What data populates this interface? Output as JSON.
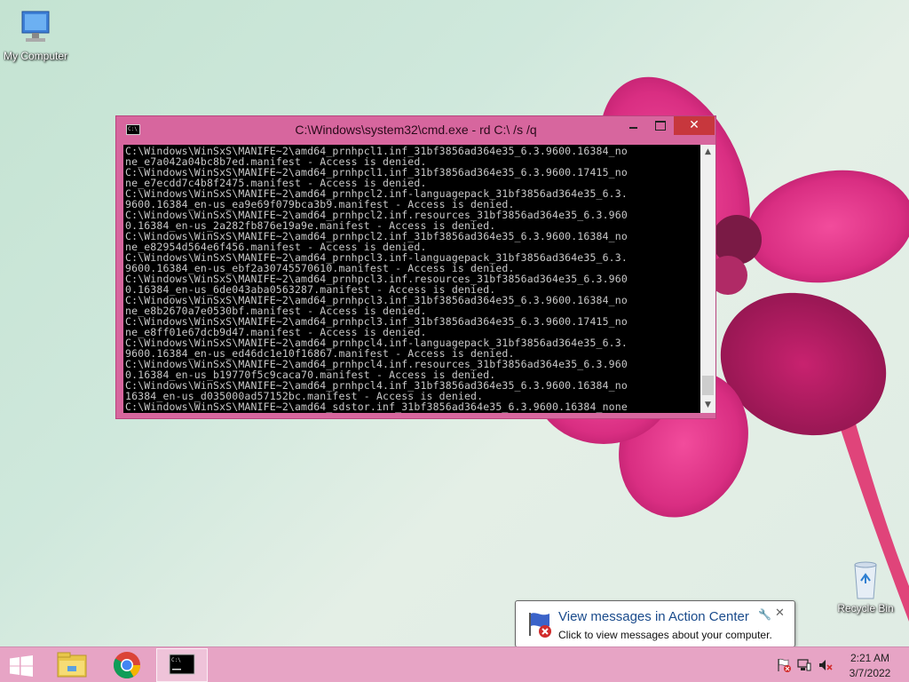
{
  "desktop": {
    "icons": [
      {
        "label": "My Computer",
        "icon": "computer-icon"
      },
      {
        "label": "Recycle Bin",
        "icon": "recycle-bin-icon"
      }
    ]
  },
  "cmd_window": {
    "title": "C:\\Windows\\system32\\cmd.exe - rd  C:\\ /s /q",
    "icon": "cmd-icon",
    "title_icon_text": "C:\\",
    "controls": {
      "minimize": "minimize",
      "maximize": "maximize",
      "close": "✕"
    },
    "colors": {
      "frame": "#d7669e",
      "close": "#c7373d"
    },
    "lines": [
      "C:\\Windows\\WinSxS\\MANIFE~2\\amd64_prnhpcl1.inf_31bf3856ad364e35_6.3.9600.16384_no",
      "ne_e7a042a04bc8b7ed.manifest - Access is denied.",
      "C:\\Windows\\WinSxS\\MANIFE~2\\amd64_prnhpcl1.inf_31bf3856ad364e35_6.3.9600.17415_no",
      "ne_e7ecdd7c4b8f2475.manifest - Access is denied.",
      "C:\\Windows\\WinSxS\\MANIFE~2\\amd64_prnhpcl2.inf-languagepack_31bf3856ad364e35_6.3.",
      "9600.16384_en-us_ea9e69f079bca3b9.manifest - Access is denied.",
      "C:\\Windows\\WinSxS\\MANIFE~2\\amd64_prnhpcl2.inf.resources_31bf3856ad364e35_6.3.960",
      "0.16384_en-us_2a282fb876e19a9e.manifest - Access is denied.",
      "C:\\Windows\\WinSxS\\MANIFE~2\\amd64_prnhpcl2.inf_31bf3856ad364e35_6.3.9600.16384_no",
      "ne_e82954d564e6f456.manifest - Access is denied.",
      "C:\\Windows\\WinSxS\\MANIFE~2\\amd64_prnhpcl3.inf-languagepack_31bf3856ad364e35_6.3.",
      "9600.16384_en-us_ebf2a30745570610.manifest - Access is denied.",
      "C:\\Windows\\WinSxS\\MANIFE~2\\amd64_prnhpcl3.inf.resources_31bf3856ad364e35_6.3.960",
      "0.16384_en-us_6de043aba0563287.manifest - Access is denied.",
      "C:\\Windows\\WinSxS\\MANIFE~2\\amd64_prnhpcl3.inf_31bf3856ad364e35_6.3.9600.16384_no",
      "ne_e8b2670a7e0530bf.manifest - Access is denied.",
      "C:\\Windows\\WinSxS\\MANIFE~2\\amd64_prnhpcl3.inf_31bf3856ad364e35_6.3.9600.17415_no",
      "ne_e8ff01e67dcb9d47.manifest - Access is denied.",
      "C:\\Windows\\WinSxS\\MANIFE~2\\amd64_prnhpcl4.inf-languagepack_31bf3856ad364e35_6.3.",
      "9600.16384_en-us_ed46dc1e10f16867.manifest - Access is denied.",
      "C:\\Windows\\WinSxS\\MANIFE~2\\amd64_prnhpcl4.inf.resources_31bf3856ad364e35_6.3.960",
      "0.16384_en-us_b19770f5c9caca70.manifest - Access is denied.",
      "C:\\Windows\\WinSxS\\MANIFE~2\\amd64_prnhpcl4.inf_31bf3856ad364e35_6.3.9600.16384_no",
      "16384_en-us_d035000ad57152bc.manifest - Access is denied.",
      "C:\\Windows\\WinSxS\\MANIFE~2\\amd64_sdstor.inf_31bf3856ad364e35_6.3.9600.16384_none"
    ]
  },
  "notification": {
    "title": "View messages in Action Center",
    "text": "Click to view messages about your computer.",
    "icon": "action-center-flag-icon",
    "close": "✕"
  },
  "taskbar": {
    "start": "windows-start-icon",
    "items": [
      {
        "name": "File Explorer",
        "icon": "file-explorer-icon"
      },
      {
        "name": "Google Chrome",
        "icon": "chrome-icon"
      },
      {
        "name": "Command Prompt",
        "icon": "cmd-icon",
        "active": true,
        "label": "C:\\"
      }
    ],
    "tray": [
      "action-center-flag-icon",
      "network-icon",
      "volume-muted-icon"
    ],
    "clock": {
      "time": "2:21 AM",
      "date": "3/7/2022"
    },
    "color": "#e7a4c5"
  }
}
